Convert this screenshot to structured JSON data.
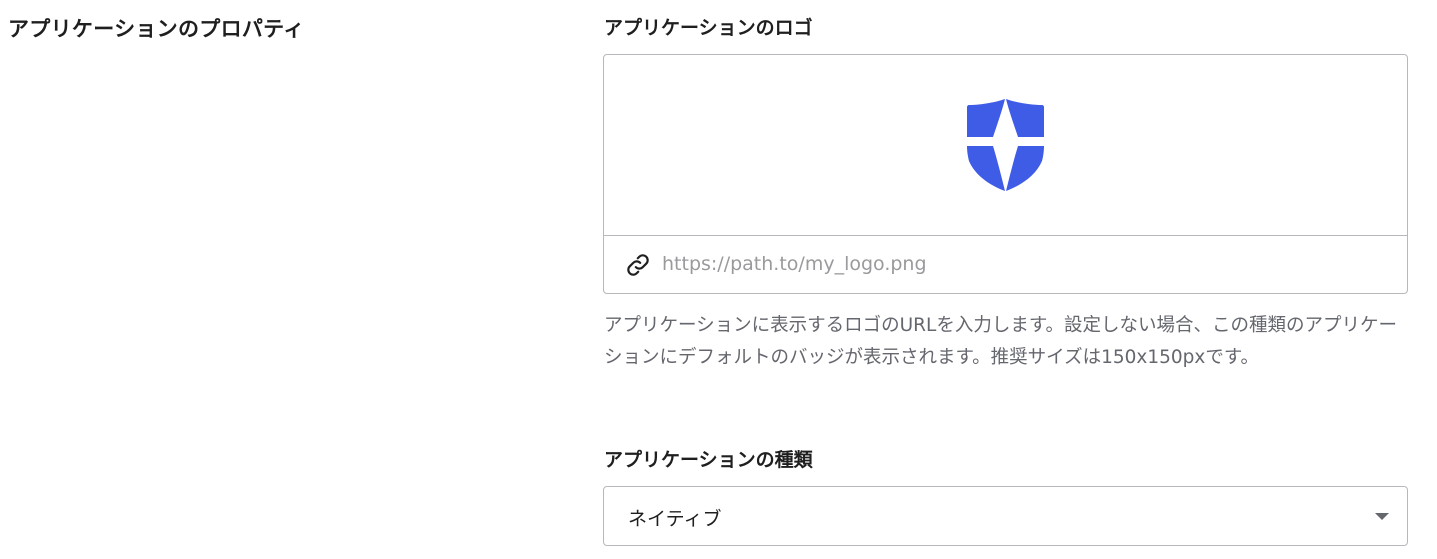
{
  "section": {
    "title": "アプリケーションのプロパティ"
  },
  "logo": {
    "label": "アプリケーションのロゴ",
    "preview_icon": "shield-logo-icon",
    "brand_color": "#3f5ce6",
    "url_placeholder": "https://path.to/my_logo.png",
    "url_value": "",
    "link_icon": "link-icon",
    "help_text": "アプリケーションに表示するロゴのURLを入力します。設定しない場合、この種類のアプリケーションにデフォルトのバッジが表示されます。推奨サイズは150x150pxです。"
  },
  "app_type": {
    "label": "アプリケーションの種類",
    "selected": "ネイティブ",
    "caret_icon": "caret-down-icon"
  }
}
